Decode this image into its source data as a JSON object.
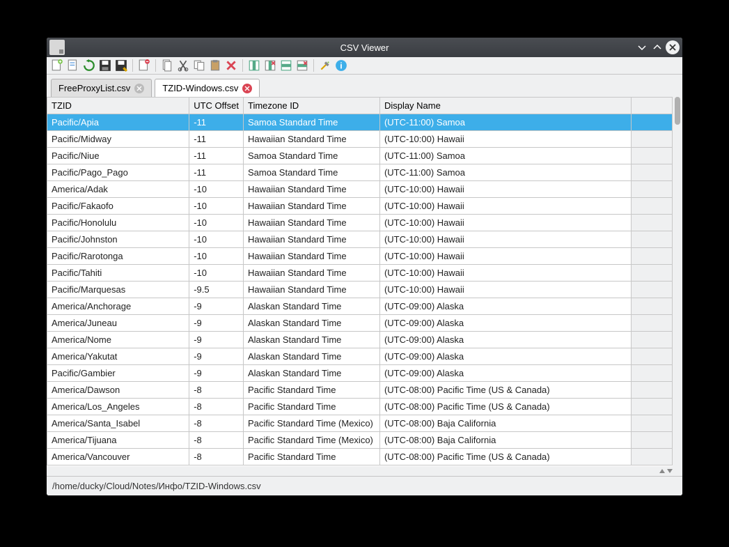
{
  "window": {
    "title": "CSV Viewer"
  },
  "tabs": [
    {
      "label": "FreeProxyList.csv",
      "active": false,
      "dirty": false
    },
    {
      "label": "TZID-Windows.csv",
      "active": true,
      "dirty": true
    }
  ],
  "columns": [
    "TZID",
    "UTC Offset",
    "Timezone ID",
    "Display Name"
  ],
  "rows": [
    {
      "tzid": "Pacific/Apia",
      "offset": "-11",
      "tzname": "Samoa Standard Time",
      "display": "(UTC-11:00) Samoa",
      "selected": true
    },
    {
      "tzid": "Pacific/Midway",
      "offset": "-11",
      "tzname": "Hawaiian Standard Time",
      "display": "(UTC-10:00) Hawaii"
    },
    {
      "tzid": "Pacific/Niue",
      "offset": "-11",
      "tzname": "Samoa Standard Time",
      "display": "(UTC-11:00) Samoa"
    },
    {
      "tzid": "Pacific/Pago_Pago",
      "offset": "-11",
      "tzname": "Samoa Standard Time",
      "display": "(UTC-11:00) Samoa"
    },
    {
      "tzid": "America/Adak",
      "offset": "-10",
      "tzname": "Hawaiian Standard Time",
      "display": "(UTC-10:00) Hawaii"
    },
    {
      "tzid": "Pacific/Fakaofo",
      "offset": "-10",
      "tzname": "Hawaiian Standard Time",
      "display": "(UTC-10:00) Hawaii"
    },
    {
      "tzid": "Pacific/Honolulu",
      "offset": "-10",
      "tzname": "Hawaiian Standard Time",
      "display": "(UTC-10:00) Hawaii"
    },
    {
      "tzid": "Pacific/Johnston",
      "offset": "-10",
      "tzname": "Hawaiian Standard Time",
      "display": "(UTC-10:00) Hawaii"
    },
    {
      "tzid": "Pacific/Rarotonga",
      "offset": "-10",
      "tzname": "Hawaiian Standard Time",
      "display": "(UTC-10:00) Hawaii"
    },
    {
      "tzid": "Pacific/Tahiti",
      "offset": "-10",
      "tzname": "Hawaiian Standard Time",
      "display": "(UTC-10:00) Hawaii"
    },
    {
      "tzid": "Pacific/Marquesas",
      "offset": "-9.5",
      "tzname": "Hawaiian Standard Time",
      "display": "(UTC-10:00) Hawaii"
    },
    {
      "tzid": "America/Anchorage",
      "offset": "-9",
      "tzname": "Alaskan Standard Time",
      "display": "(UTC-09:00) Alaska"
    },
    {
      "tzid": "America/Juneau",
      "offset": "-9",
      "tzname": "Alaskan Standard Time",
      "display": "(UTC-09:00) Alaska"
    },
    {
      "tzid": "America/Nome",
      "offset": "-9",
      "tzname": "Alaskan Standard Time",
      "display": "(UTC-09:00) Alaska"
    },
    {
      "tzid": "America/Yakutat",
      "offset": "-9",
      "tzname": "Alaskan Standard Time",
      "display": "(UTC-09:00) Alaska"
    },
    {
      "tzid": "Pacific/Gambier",
      "offset": "-9",
      "tzname": "Alaskan Standard Time",
      "display": "(UTC-09:00) Alaska"
    },
    {
      "tzid": "America/Dawson",
      "offset": "-8",
      "tzname": "Pacific Standard Time",
      "display": "(UTC-08:00) Pacific Time (US & Canada)"
    },
    {
      "tzid": "America/Los_Angeles",
      "offset": "-8",
      "tzname": "Pacific Standard Time",
      "display": "(UTC-08:00) Pacific Time (US & Canada)"
    },
    {
      "tzid": "America/Santa_Isabel",
      "offset": "-8",
      "tzname": "Pacific Standard Time (Mexico)",
      "display": "(UTC-08:00) Baja California"
    },
    {
      "tzid": "America/Tijuana",
      "offset": "-8",
      "tzname": "Pacific Standard Time (Mexico)",
      "display": "(UTC-08:00) Baja California"
    },
    {
      "tzid": "America/Vancouver",
      "offset": "-8",
      "tzname": "Pacific Standard Time",
      "display": "(UTC-08:00) Pacific Time (US & Canada)"
    }
  ],
  "statusbar": {
    "path": "/home/ducky/Cloud/Notes/Инфо/TZID-Windows.csv"
  }
}
